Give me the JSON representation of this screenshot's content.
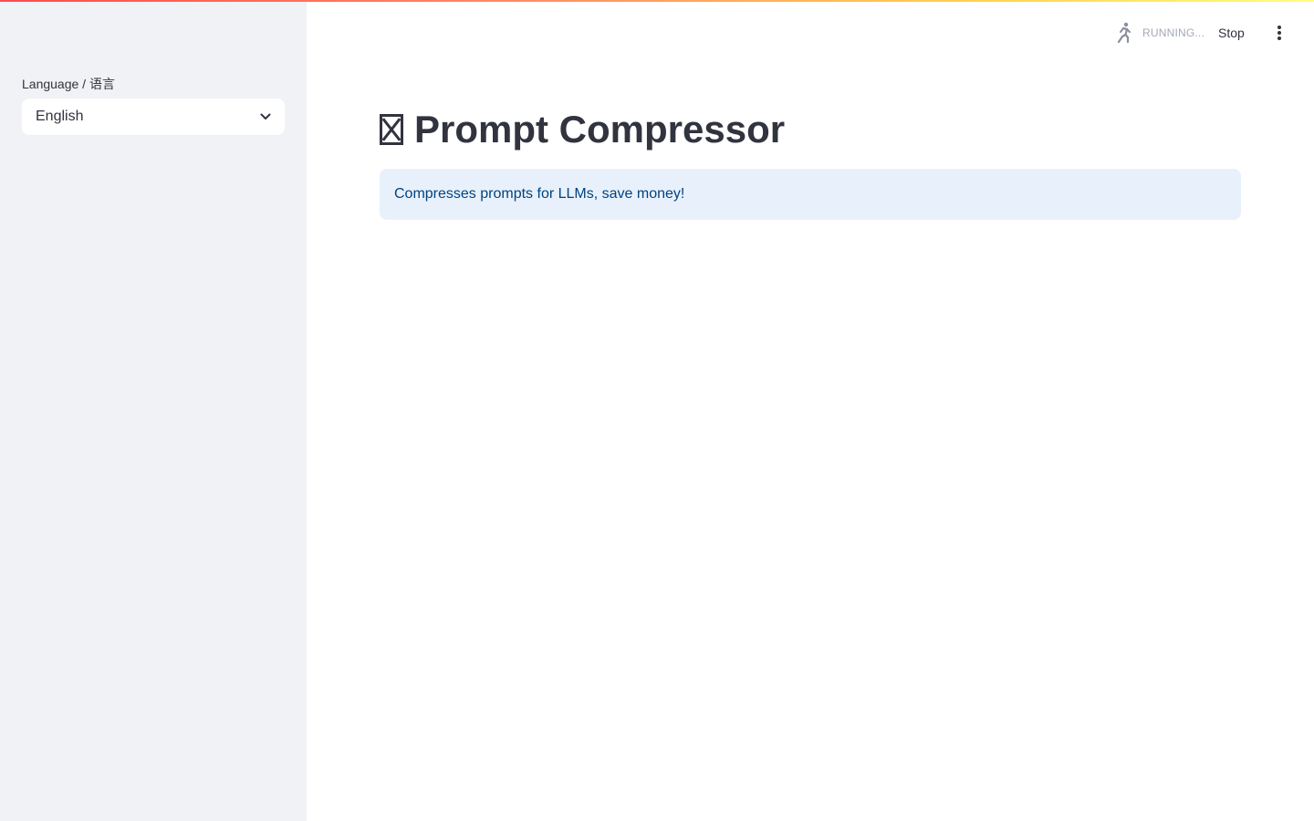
{
  "app": {
    "title": "Prompt Compressor",
    "title_icon": "unknown-glyph-icon"
  },
  "sidebar": {
    "language_label": "Language / 语言",
    "language_select": {
      "value": "English",
      "icon": "chevron-down-icon"
    }
  },
  "header": {
    "status_text": "RUNNING...",
    "status_icon": "running-man-icon",
    "stop_label": "Stop",
    "menu_icon": "kebab-menu-icon"
  },
  "main": {
    "info_message": "Compresses prompts for LLMs, save money!"
  },
  "colors": {
    "sidebar_bg": "#f0f2f6",
    "info_bg": "#e8f1fb",
    "info_text": "#004280",
    "text_primary": "#31333f",
    "status_text": "#a3a8b8",
    "accent_gradient_start": "#ff4b4b",
    "accent_gradient_end": "#fffd80"
  }
}
